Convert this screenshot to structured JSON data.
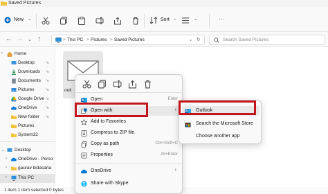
{
  "window": {
    "title": "Saved Pictures"
  },
  "toolbar": {
    "new_label": "New",
    "sort_label": "Sort",
    "more_label": "···",
    "icons": [
      "cut-icon",
      "copy-icon",
      "paste-icon",
      "rename-icon",
      "share-icon",
      "delete-icon",
      "sort-icon",
      "view-icon"
    ]
  },
  "address": {
    "path": [
      "This PC",
      "Pictures",
      "Saved Pictures"
    ],
    "sep": ">",
    "search_placeholder": "Search Saved Pictures"
  },
  "sidebar": {
    "items": [
      {
        "label": "Home",
        "icon": "home-icon",
        "pinned": false,
        "chevron": ">"
      },
      {
        "label": "Desktop",
        "icon": "desktop-icon",
        "pinned": true
      },
      {
        "label": "Downloads",
        "icon": "downloads-icon",
        "pinned": true
      },
      {
        "label": "Documents",
        "icon": "documents-icon",
        "pinned": true
      },
      {
        "label": "Pictures",
        "icon": "pictures-icon",
        "pinned": true
      },
      {
        "label": "Google Drive",
        "icon": "google-drive-icon",
        "pinned": true
      },
      {
        "label": "OneDrive",
        "icon": "onedrive-icon",
        "pinned": true
      },
      {
        "label": "New folder",
        "icon": "folder-icon",
        "pinned": true
      },
      {
        "label": "Pictures",
        "icon": "folder-icon",
        "pinned": false
      },
      {
        "label": "System32",
        "icon": "folder-icon",
        "pinned": false
      },
      {
        "label": "Desktop",
        "icon": "desktop-icon",
        "pinned": false,
        "chevron": "v"
      },
      {
        "label": "OneDrive - Perso",
        "icon": "onedrive-icon",
        "pinned": false,
        "chevron": ">"
      },
      {
        "label": "gaurav bidasaria",
        "icon": "user-folder-icon",
        "pinned": false,
        "chevron": ">"
      },
      {
        "label": "This PC",
        "icon": "this-pc-icon",
        "pinned": false,
        "chevron": ">"
      }
    ]
  },
  "content": {
    "file_label": "outl",
    "file_icon": "envelope-icon"
  },
  "status": {
    "text": "1 item    1 item selected 0 bytes"
  },
  "context_menu": {
    "quick_actions": [
      "cut-icon",
      "copy-icon",
      "rename-icon",
      "share-icon",
      "delete-icon"
    ],
    "items": [
      {
        "label": "Open",
        "shortcut": "Enter",
        "icon": "outlook-icon"
      },
      {
        "label": "Open with",
        "shortcut": "",
        "submenu": true,
        "icon": "open-with-icon"
      },
      {
        "label": "Add to Favorites",
        "shortcut": "",
        "icon": "star-icon"
      },
      {
        "label": "Compress to ZIP file",
        "shortcut": "",
        "icon": "zip-icon"
      },
      {
        "label": "Copy as path",
        "shortcut": "Ctrl+Shift+C",
        "icon": "copy-path-icon"
      },
      {
        "label": "Properties",
        "shortcut": "Alt+Enter",
        "icon": "properties-icon"
      },
      {
        "label": "OneDrive",
        "shortcut": "",
        "submenu": true,
        "icon": "onedrive-icon"
      },
      {
        "label": "Share with Skype",
        "shortcut": "",
        "icon": "skype-icon"
      }
    ]
  },
  "submenu": {
    "items": [
      {
        "label": "Outlook",
        "icon": "outlook-icon"
      },
      {
        "label": "Search the Microsoft Store",
        "icon": "store-icon"
      },
      {
        "label": "Choose another app",
        "icon": ""
      }
    ]
  },
  "colors": {
    "accent": "#0067c0",
    "highlight_border": "#c4151c",
    "folder": "#f2c33c"
  }
}
